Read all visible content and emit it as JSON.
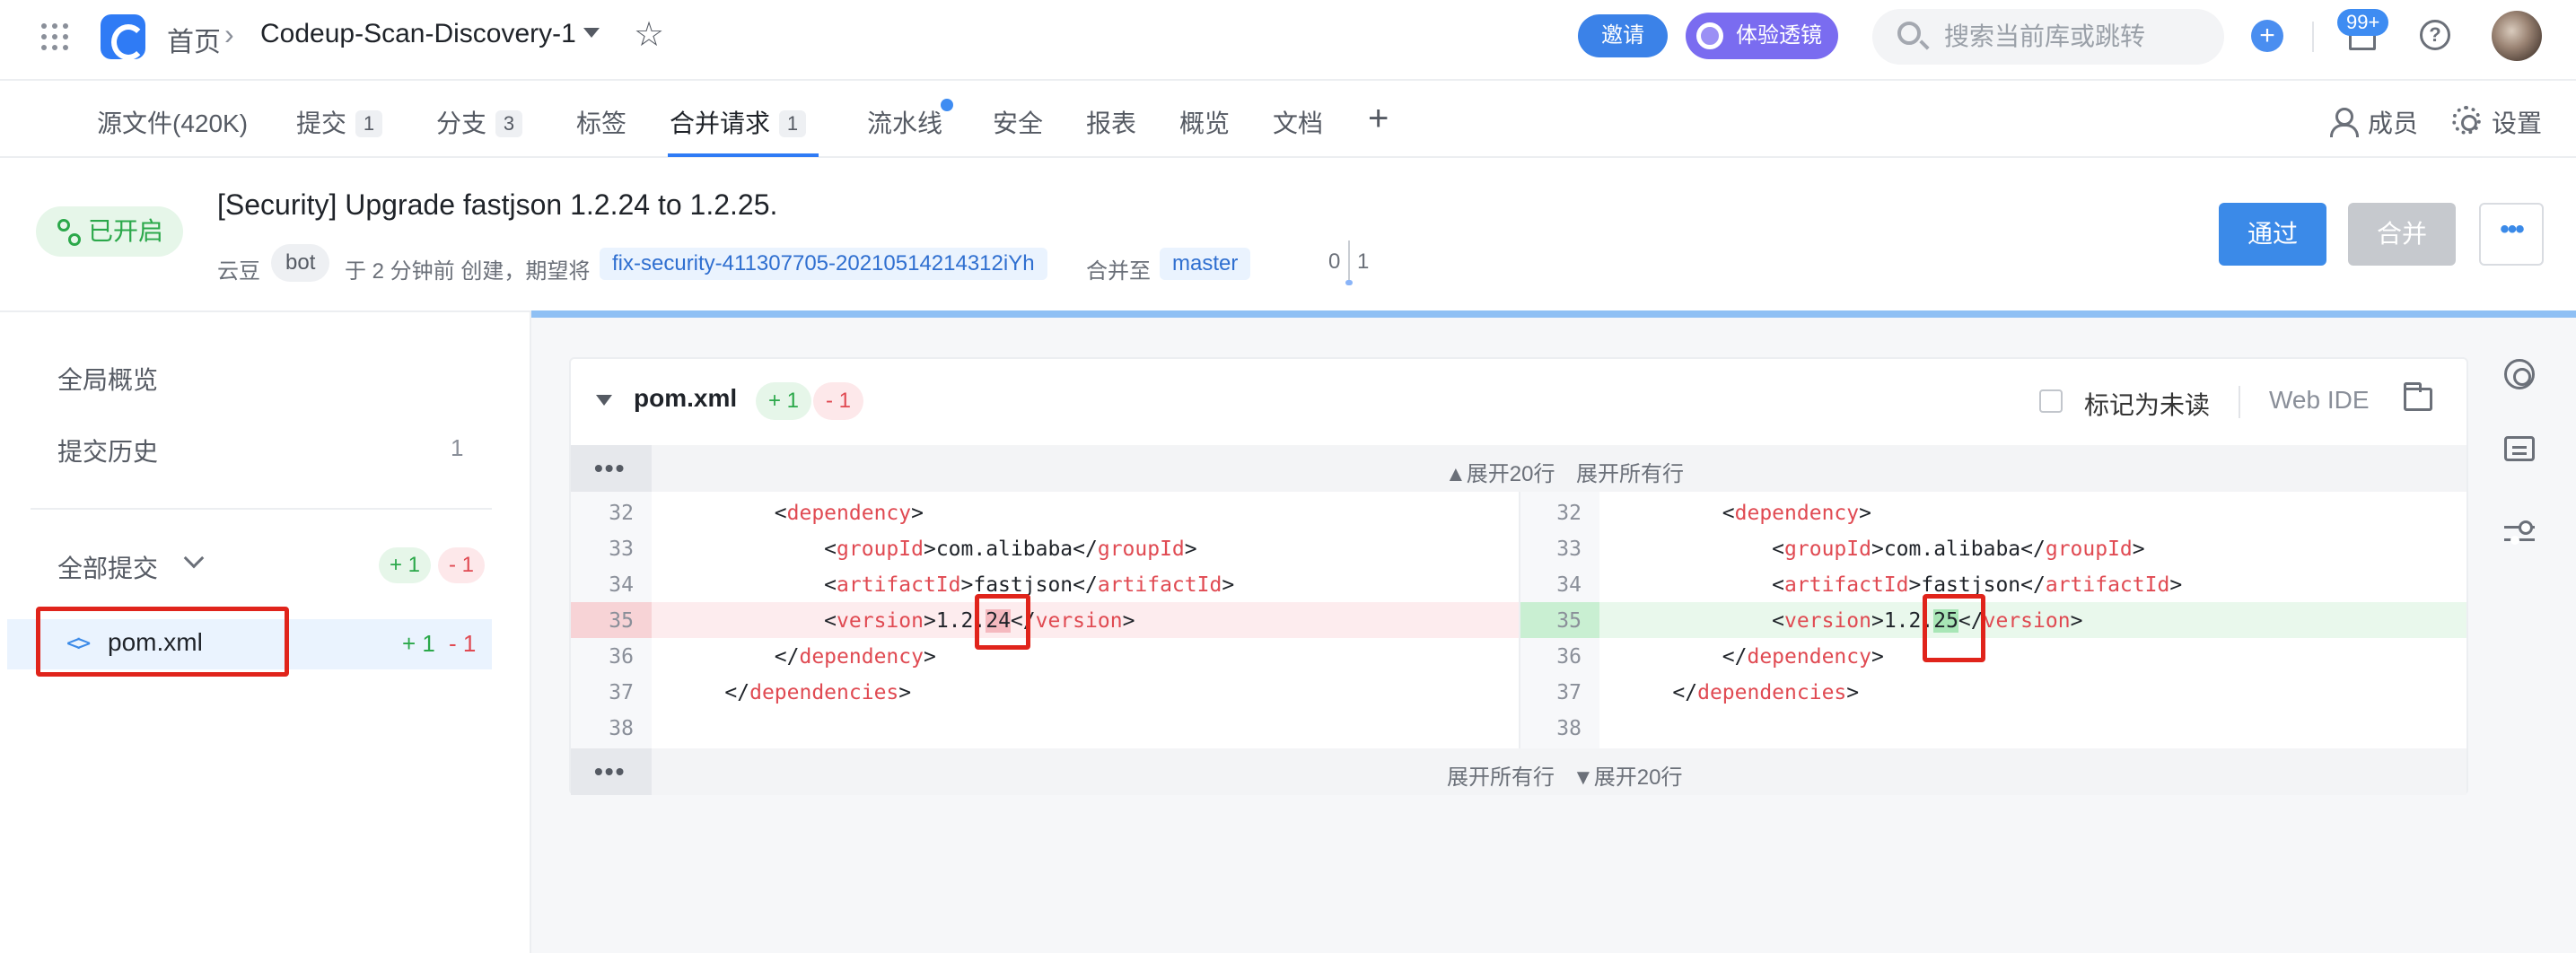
{
  "topbar": {
    "home": "首页",
    "repo": "Codeup-Scan-Discovery-1",
    "invite": "邀请",
    "lens": "体验透镜",
    "search_placeholder": "搜索当前库或跳转",
    "notifications": "99+"
  },
  "tabs": [
    {
      "label": "源文件(420K)"
    },
    {
      "label": "提交",
      "count": "1"
    },
    {
      "label": "分支",
      "count": "3"
    },
    {
      "label": "标签"
    },
    {
      "label": "合并请求",
      "count": "1"
    },
    {
      "label": "流水线"
    },
    {
      "label": "安全"
    },
    {
      "label": "报表"
    },
    {
      "label": "概览"
    },
    {
      "label": "文档"
    }
  ],
  "tab_right": {
    "members": "成员",
    "settings": "设置"
  },
  "mr": {
    "status": "已开启",
    "title": "[Security] Upgrade fastjson 1.2.24 to 1.2.25.",
    "author": "云豆",
    "author_tag": "bot",
    "created": "于 2 分钟前 创建，期望将",
    "source_branch": "fix-security-411307705-20210514214312iYh",
    "merge_into": "合并至",
    "target_branch": "master",
    "deletions": "0",
    "additions": "1",
    "approve": "通过",
    "merge": "合并",
    "more": "•••"
  },
  "sidebar": {
    "overview": "全局概览",
    "history": "提交历史",
    "history_count": "1",
    "all_commits": "全部提交",
    "all_add": "+ 1",
    "all_del": "- 1",
    "file_name": "pom.xml",
    "file_add": "+ 1",
    "file_del": "- 1"
  },
  "diff": {
    "file": "pom.xml",
    "add": "+ 1",
    "del": "- 1",
    "mark_unread": "标记为未读",
    "web_ide": "Web IDE",
    "expand_up_20": "▲展开20行",
    "expand_all": "展开所有行",
    "expand_down_20": "▼展开20行",
    "left_lines": [
      {
        "n": "32",
        "indent": "        ",
        "parts": [
          [
            "t",
            "<"
          ],
          [
            "g",
            "dependency"
          ],
          [
            "t",
            ">"
          ]
        ]
      },
      {
        "n": "33",
        "indent": "            ",
        "parts": [
          [
            "t",
            "<"
          ],
          [
            "g",
            "groupId"
          ],
          [
            "t",
            ">com.alibaba</"
          ],
          [
            "g",
            "groupId"
          ],
          [
            "t",
            ">"
          ]
        ]
      },
      {
        "n": "34",
        "indent": "            ",
        "parts": [
          [
            "t",
            "<"
          ],
          [
            "g",
            "artifactId"
          ],
          [
            "t",
            ">fastjson</"
          ],
          [
            "g",
            "artifactId"
          ],
          [
            "t",
            ">"
          ]
        ]
      },
      {
        "n": "35",
        "indent": "            ",
        "parts": [
          [
            "t",
            "<"
          ],
          [
            "g",
            "version"
          ],
          [
            "t",
            ">1.2."
          ],
          [
            "d",
            "24"
          ],
          [
            "t",
            "</"
          ],
          [
            "g",
            "version"
          ],
          [
            "t",
            ">"
          ]
        ]
      },
      {
        "n": "36",
        "indent": "        ",
        "parts": [
          [
            "t",
            "</"
          ],
          [
            "g",
            "dependency"
          ],
          [
            "t",
            ">"
          ]
        ]
      },
      {
        "n": "37",
        "indent": "    ",
        "parts": [
          [
            "t",
            "</"
          ],
          [
            "g",
            "dependencies"
          ],
          [
            "t",
            ">"
          ]
        ]
      },
      {
        "n": "38",
        "indent": "",
        "parts": []
      }
    ],
    "right_lines": [
      {
        "n": "32",
        "indent": "        ",
        "parts": [
          [
            "t",
            "<"
          ],
          [
            "g",
            "dependency"
          ],
          [
            "t",
            ">"
          ]
        ]
      },
      {
        "n": "33",
        "indent": "            ",
        "parts": [
          [
            "t",
            "<"
          ],
          [
            "g",
            "groupId"
          ],
          [
            "t",
            ">com.alibaba</"
          ],
          [
            "g",
            "groupId"
          ],
          [
            "t",
            ">"
          ]
        ]
      },
      {
        "n": "34",
        "indent": "            ",
        "parts": [
          [
            "t",
            "<"
          ],
          [
            "g",
            "artifactId"
          ],
          [
            "t",
            ">fastjson</"
          ],
          [
            "g",
            "artifactId"
          ],
          [
            "t",
            ">"
          ]
        ]
      },
      {
        "n": "35",
        "indent": "            ",
        "parts": [
          [
            "t",
            "<"
          ],
          [
            "g",
            "version"
          ],
          [
            "t",
            ">1.2."
          ],
          [
            "a",
            "25"
          ],
          [
            "t",
            "</"
          ],
          [
            "g",
            "version"
          ],
          [
            "t",
            ">"
          ]
        ]
      },
      {
        "n": "36",
        "indent": "        ",
        "parts": [
          [
            "t",
            "</"
          ],
          [
            "g",
            "dependency"
          ],
          [
            "t",
            ">"
          ]
        ]
      },
      {
        "n": "37",
        "indent": "    ",
        "parts": [
          [
            "t",
            "</"
          ],
          [
            "g",
            "dependencies"
          ],
          [
            "t",
            ">"
          ]
        ]
      },
      {
        "n": "38",
        "indent": "",
        "parts": []
      }
    ]
  }
}
